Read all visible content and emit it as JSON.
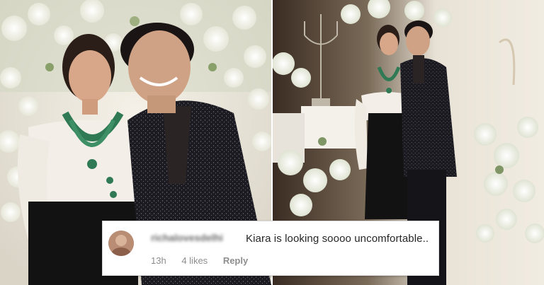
{
  "scene": {
    "left_photo": "couple-photo-left",
    "right_photo": "couple-photo-right"
  },
  "comment": {
    "username": "richalovesdelhi",
    "text": "Kiara is looking soooo uncomfortable..",
    "time": "13h",
    "likes": "4 likes",
    "reply": "Reply"
  },
  "colors": {
    "card_background": "#ffffff",
    "text_primary": "#262626",
    "text_secondary": "#8e8e8e",
    "suit": "#1c1a20",
    "gown_top": "#f3efe8",
    "gown_bottom": "#121212",
    "necklace": "#2f7a55"
  }
}
